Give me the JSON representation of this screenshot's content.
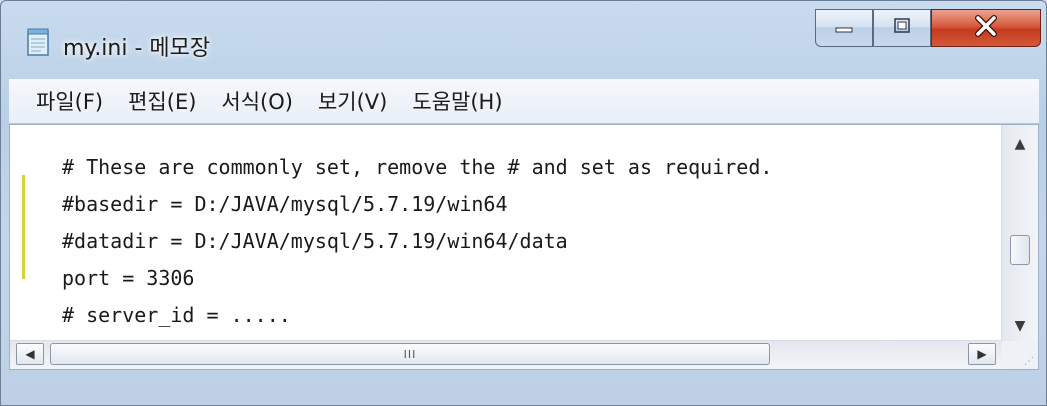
{
  "window": {
    "title": "my.ini - 메모장"
  },
  "menu": {
    "items": [
      {
        "label": "파일(F)"
      },
      {
        "label": "편집(E)"
      },
      {
        "label": "서식(O)"
      },
      {
        "label": "보기(V)"
      },
      {
        "label": "도움말(H)"
      }
    ]
  },
  "editor": {
    "lines": [
      "# These are commonly set, remove the # and set as required.",
      "#basedir = D:/JAVA/mysql/5.7.19/win64",
      "#datadir = D:/JAVA/mysql/5.7.19/win64/data",
      "port = 3306",
      "# server_id = ....."
    ]
  },
  "scrollbar": {
    "thumb_grip": "III"
  },
  "icons": {
    "app": "notepad-icon",
    "minimize": "minimize-icon",
    "maximize": "maximize-icon",
    "close": "close-icon"
  },
  "colors": {
    "close_button": "#c9432a",
    "frame": "#c4d6ea"
  }
}
